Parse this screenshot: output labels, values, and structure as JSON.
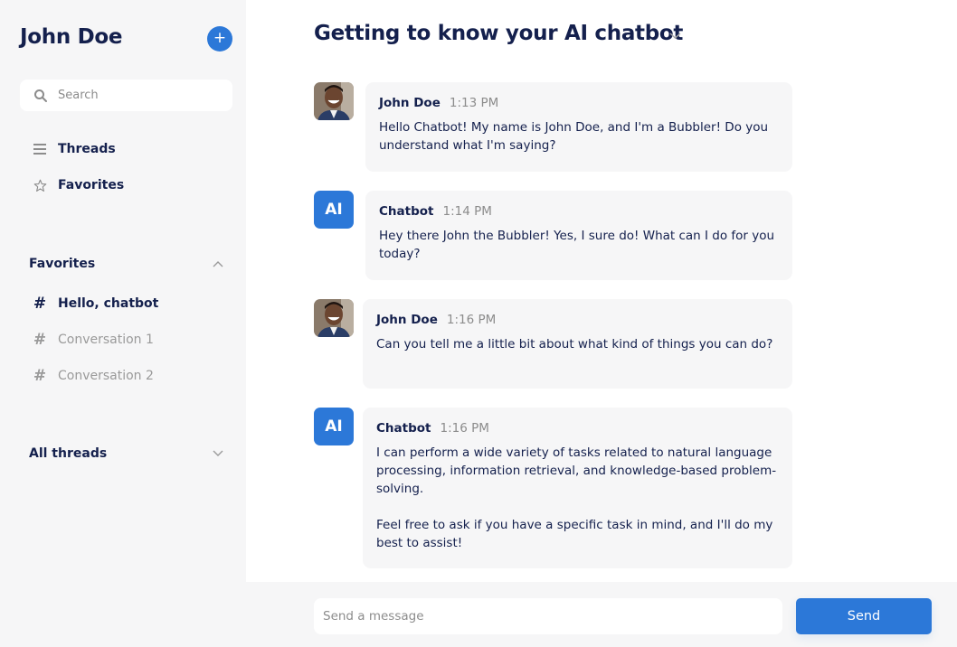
{
  "sidebar": {
    "user_name": "John Doe",
    "add_button_label": "+",
    "search": {
      "placeholder": "Search",
      "value": ""
    },
    "nav": [
      {
        "label": "Threads",
        "icon": "menu-icon"
      },
      {
        "label": "Favorites",
        "icon": "star-icon"
      }
    ],
    "favorites_section": {
      "label": "Favorites",
      "expanded": true,
      "threads": [
        {
          "label": "Hello, chatbot",
          "active": true
        },
        {
          "label": "Conversation 1",
          "active": false
        },
        {
          "label": "Conversation 2",
          "active": false
        }
      ]
    },
    "all_threads_section": {
      "label": "All threads",
      "expanded": false
    }
  },
  "main": {
    "title": "Getting to know your AI chatbot",
    "messages": [
      {
        "sender": "John Doe",
        "avatar": "user-photo",
        "time": "1:13 PM",
        "text": "Hello Chatbot! My name is John Doe, and I'm a Bubbler! Do you understand what I'm saying?"
      },
      {
        "sender": "Chatbot",
        "avatar": "AI",
        "time": "1:14 PM",
        "text": "Hey there John the Bubbler! Yes, I sure do! What can I do for you today?"
      },
      {
        "sender": "John Doe",
        "avatar": "user-photo",
        "time": "1:16 PM",
        "text": "Can you tell me a little bit about what kind of things you can do?"
      },
      {
        "sender": "Chatbot",
        "avatar": "AI",
        "time": "1:16 PM",
        "text": "I can perform a wide variety of tasks related to natural language processing, information retrieval, and knowledge-based problem-solving.\n\nFeel free to ask if you have a specific task in mind, and I'll do my best to assist!"
      }
    ]
  },
  "composer": {
    "placeholder": "Send a message",
    "value": "",
    "send_label": "Send"
  },
  "colors": {
    "accent": "#2c78d8",
    "text_primary": "#14204d",
    "text_muted": "#8c8c8c",
    "sidebar_bg": "#f6f6f7"
  }
}
